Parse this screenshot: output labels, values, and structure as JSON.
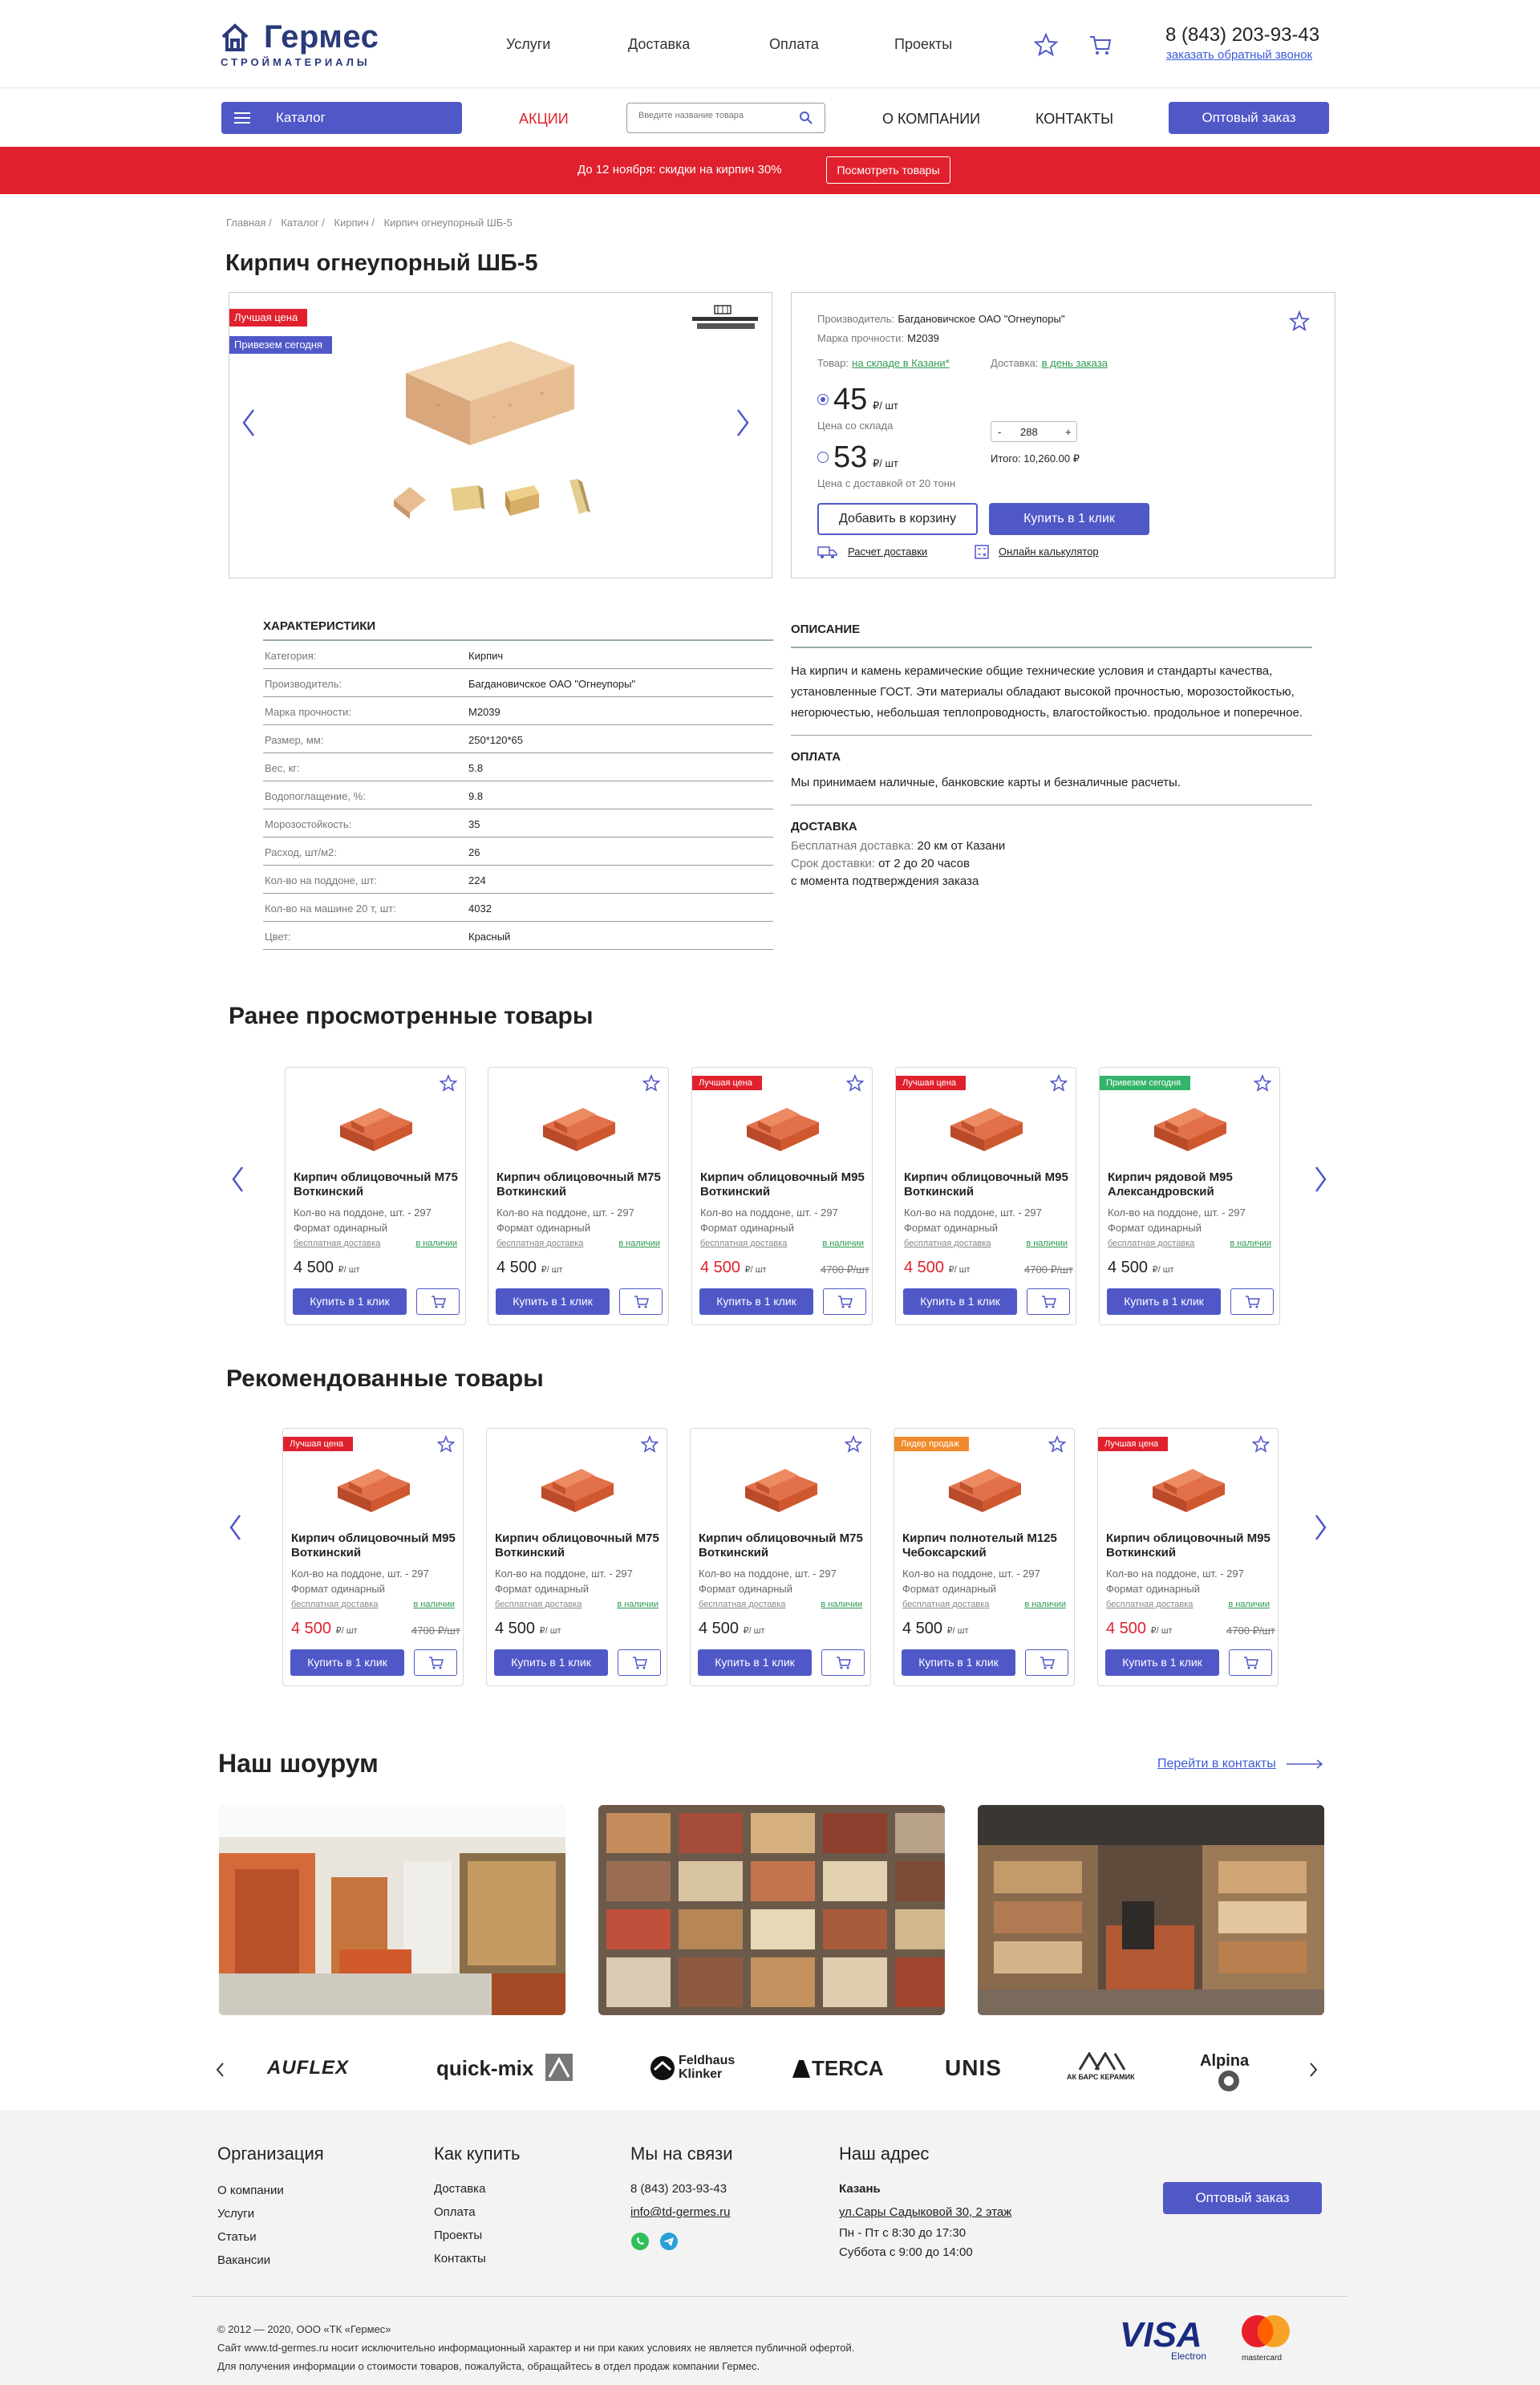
{
  "header": {
    "logo_name": "Гермес",
    "logo_sub": "СТРОЙМАТЕРИАЛЫ",
    "nav": [
      "Услуги",
      "Доставка",
      "Оплата",
      "Проекты"
    ],
    "phone": "8 (843) 203-93-43",
    "callback": "заказать обратный звонок"
  },
  "navbar": {
    "catalog": "Каталог",
    "akcii": "АКЦИИ",
    "search_placeholder": "Введите название товара",
    "about": "О КОМПАНИИ",
    "contacts": "КОНТАКТЫ",
    "wholesale": "Оптовый заказ"
  },
  "promo": {
    "text": "До 12 ноября: скидки на кирпич 30%",
    "button": "Посмотреть товары"
  },
  "breadcrumb": [
    "Главная",
    "/",
    "Каталог",
    "/",
    "Кирпич",
    "/",
    "Кирпич огнеупорный ШБ-5"
  ],
  "product": {
    "title": "Кирпич огнеупорный ШБ-5",
    "badge_best": "Лучшая цена",
    "badge_today": "Привезем сегодня",
    "manufacturer_label": "Производитель:",
    "manufacturer": "Багдановичское ОАО \"Огнеупоры\"",
    "grade_label": "Марка прочности:",
    "grade": "М2039",
    "stock_label": "Товар:",
    "stock": "на складе в Казани*",
    "delivery_label": "Доставка:",
    "delivery": "в день заказа",
    "price1": "45",
    "price1_unit": "₽/ шт",
    "price1_note": "Цена со склада",
    "price2": "53",
    "price2_unit": "₽/ шт",
    "price2_note": "Цена с доставкой от 20 тонн",
    "qty_minus": "-",
    "qty": "288",
    "qty_plus": "+",
    "total": "Итого: 10,260.00 ₽",
    "add_to_cart": "Добавить в корзину",
    "buy_one_click": "Купить в 1 клик",
    "calc_delivery": "Расчет доставки",
    "online_calc": "Онлайн калькулятор"
  },
  "specs": {
    "title": "ХАРАКТЕРИСТИКИ",
    "rows": [
      {
        "k": "Категория:",
        "v": "Кирпич"
      },
      {
        "k": "Производитель:",
        "v": "Багдановичское ОАО \"Огнеупоры\""
      },
      {
        "k": "Марка прочности:",
        "v": "М2039"
      },
      {
        "k": "Размер, мм:",
        "v": "250*120*65"
      },
      {
        "k": "Вес, кг:",
        "v": "5.8"
      },
      {
        "k": "Водопоглащение, %:",
        "v": "9.8"
      },
      {
        "k": "Морозостойкость:",
        "v": "35"
      },
      {
        "k": "Расход, шт/м2:",
        "v": "26"
      },
      {
        "k": "Кол-во на поддоне, шт:",
        "v": "224"
      },
      {
        "k": "Кол-во на машине 20 т, шт:",
        "v": "4032"
      },
      {
        "k": "Цвет:",
        "v": "Красный"
      }
    ]
  },
  "description": {
    "title": "ОПИСАНИЕ",
    "text": "На кирпич и камень керамические общие технические условия и стандарты качества, установленные ГОСТ. Эти материалы обладают высокой прочностью, морозостойкостью, негорючестью, небольшая теплопроводность, влагостойкостью. продольное и поперечное.",
    "pay_title": "ОПЛАТА",
    "pay_text": "Мы принимаем наличные, банковские карты и безналичные расчеты.",
    "del_title": "ДОСТАВКА",
    "del_free_label": "Бесплатная доставка:",
    "del_free": "20 км от Казани",
    "del_time_label": "Срок доставки:",
    "del_time": "от 2 до 20 часов",
    "del_note": "с момента подтверждения заказа"
  },
  "viewed": {
    "title": "Ранее просмотренные товары",
    "cards": [
      {
        "badge": "",
        "name": "Кирпич облицовочный М75 Воткинский",
        "info1": "Кол-во на поддоне, шт. - 297",
        "info2": "Формат одинарный",
        "free": "бесплатная доставка",
        "stock": "в наличии",
        "price": "4 500",
        "unit": "₽/ шт",
        "old": "",
        "buy": "Купить в 1 клик"
      },
      {
        "badge": "",
        "name": "Кирпич облицовочный М75 Воткинский",
        "info1": "Кол-во на поддоне, шт. - 297",
        "info2": "Формат одинарный",
        "free": "бесплатная доставка",
        "stock": "в наличии",
        "price": "4 500",
        "unit": "₽/ шт",
        "old": "",
        "buy": "Купить в 1 клик"
      },
      {
        "badge": "Лучшая цена",
        "name": "Кирпич облицовочный М95 Воткинский",
        "info1": "Кол-во на поддоне, шт. - 297",
        "info2": "Формат одинарный",
        "free": "бесплатная доставка",
        "stock": "в наличии",
        "price": "4 500",
        "unit": "₽/ шт",
        "old": "4700 ₽/шт",
        "buy": "Купить в 1 клик"
      },
      {
        "badge": "Лучшая цена",
        "name": "Кирпич облицовочный М95 Воткинский",
        "info1": "Кол-во на поддоне, шт. - 297",
        "info2": "Формат одинарный",
        "free": "бесплатная доставка",
        "stock": "в наличии",
        "price": "4 500",
        "unit": "₽/ шт",
        "old": "4700 ₽/шт",
        "buy": "Купить в 1 клик"
      },
      {
        "badge": "Привезем сегодня",
        "name": "Кирпич рядовой М95 Александровский",
        "info1": "Кол-во на поддоне, шт. - 297",
        "info2": "Формат одинарный",
        "free": "бесплатная доставка",
        "stock": "в наличии",
        "price": "4 500",
        "unit": "₽/ шт",
        "old": "",
        "buy": "Купить в 1 клик"
      }
    ]
  },
  "recommended": {
    "title": "Рекомендованные товары",
    "cards": [
      {
        "badge": "Лучшая цена",
        "name": "Кирпич облицовочный М95 Воткинский",
        "info1": "Кол-во на поддоне, шт. - 297",
        "info2": "Формат одинарный",
        "free": "бесплатная доставка",
        "stock": "в наличии",
        "price": "4 500",
        "unit": "₽/ шт",
        "old": "4700 ₽/шт",
        "buy": "Купить в 1 клик"
      },
      {
        "badge": "",
        "name": "Кирпич облицовочный М75 Воткинский",
        "info1": "Кол-во на поддоне, шт. - 297",
        "info2": "Формат одинарный",
        "free": "бесплатная доставка",
        "stock": "в наличии",
        "price": "4 500",
        "unit": "₽/ шт",
        "old": "",
        "buy": "Купить в 1 клик"
      },
      {
        "badge": "",
        "name": "Кирпич облицовочный М75 Воткинский",
        "info1": "Кол-во на поддоне, шт. - 297",
        "info2": "Формат одинарный",
        "free": "бесплатная доставка",
        "stock": "в наличии",
        "price": "4 500",
        "unit": "₽/ шт",
        "old": "",
        "buy": "Купить в 1 клик"
      },
      {
        "badge": "Лидер продаж",
        "name": "Кирпич полнотелый М125 Чебоксарский",
        "info1": "Кол-во на поддоне, шт. - 297",
        "info2": "Формат одинарный",
        "free": "бесплатная доставка",
        "stock": "в наличии",
        "price": "4 500",
        "unit": "₽/ шт",
        "old": "",
        "buy": "Купить в 1 клик"
      },
      {
        "badge": "Лучшая цена",
        "name": "Кирпич облицовочный М95 Воткинский",
        "info1": "Кол-во на поддоне, шт. - 297",
        "info2": "Формат одинарный",
        "free": "бесплатная доставка",
        "stock": "в наличии",
        "price": "4 500",
        "unit": "₽/ шт",
        "old": "4700 ₽/шт",
        "buy": "Купить в 1 клик"
      }
    ]
  },
  "showroom": {
    "title": "Наш шоурум",
    "link": "Перейти в контакты"
  },
  "brands": [
    "AUFLEX",
    "quick-mix",
    "Feldhaus Klinker",
    "TERCA",
    "UNIS",
    "АК БАРС КЕРАМИК",
    "Alpina"
  ],
  "footer": {
    "org_title": "Организация",
    "org_links": [
      "О компании",
      "Услуги",
      "Статьи",
      "Вакансии"
    ],
    "buy_title": "Как купить",
    "buy_links": [
      "Доставка",
      "Оплата",
      "Проекты",
      "Контакты"
    ],
    "contact_title": "Мы на связи",
    "phone": "8 (843) 203-93-43",
    "email": "info@td-germes.ru",
    "addr_title": "Наш адрес",
    "city": "Казань",
    "street": "ул.Сары Садыковой 30, 2 этаж",
    "hours1": "Пн - Пт с 8:30 до 17:30",
    "hours2": "Суббота с 9:00 до 14:00",
    "wholesale": "Оптовый заказ",
    "copy1": "© 2012 — 2020, ООО «ТК «Гермес»",
    "copy2": "Сайт www.td-germes.ru носит исключительно информационный характер и ни при каких условиях не является публичной офертой.",
    "copy3": "Для получения информации о стоимости товаров, пожалуйста, обращайтесь в отдел продаж компании Гермес.",
    "visa": "VISA",
    "visa_sub": "Electron",
    "mc": "mastercard"
  },
  "colors": {
    "accent": "#5058c8",
    "red": "#e0212d",
    "green": "#2f9a52",
    "orange": "#f08a2b"
  }
}
